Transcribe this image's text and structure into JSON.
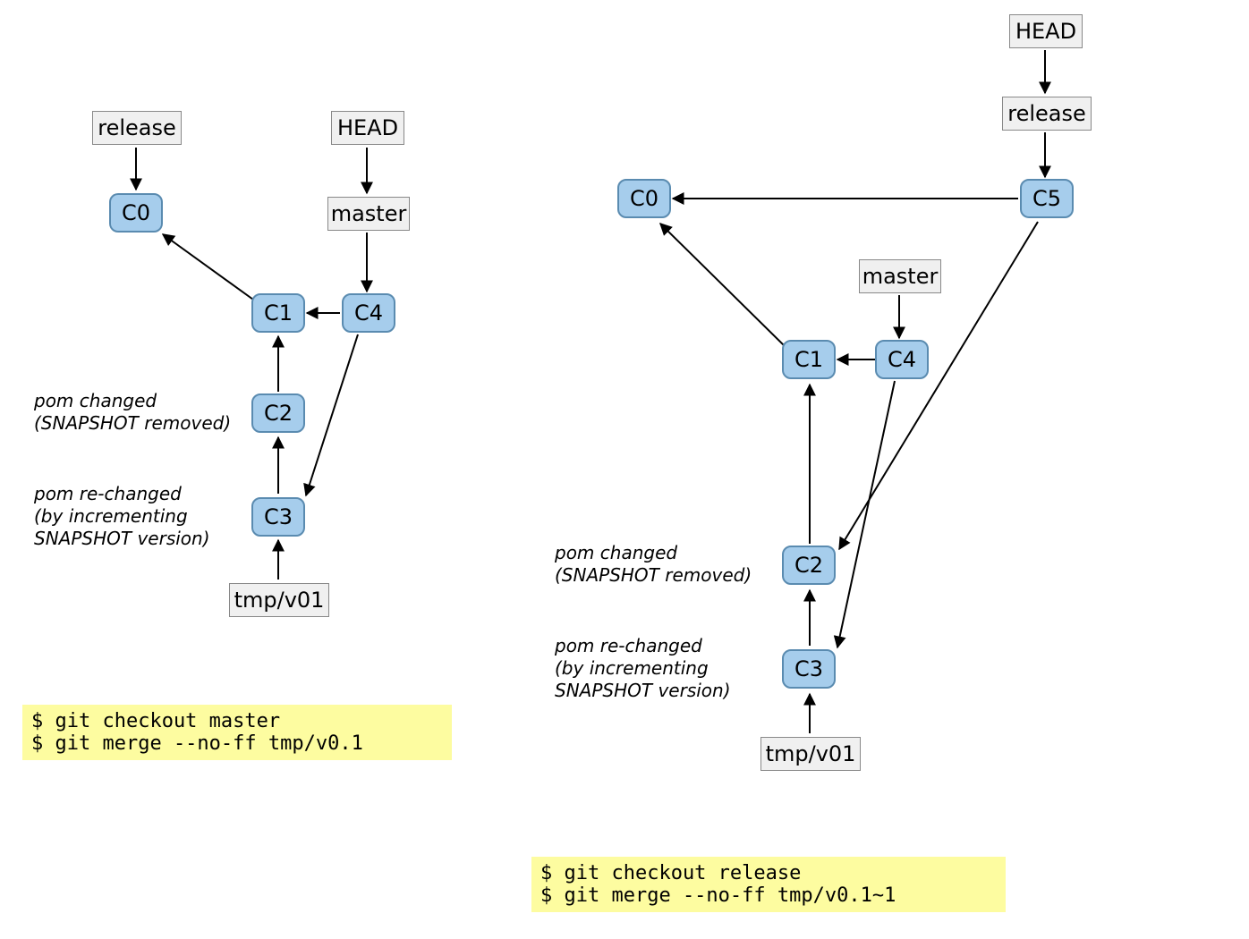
{
  "left": {
    "refs": {
      "release": "release",
      "head": "HEAD",
      "master": "master",
      "tmp": "tmp/v01"
    },
    "commits": {
      "c0": "C0",
      "c1": "C1",
      "c2": "C2",
      "c3": "C3",
      "c4": "C4"
    },
    "annotations": {
      "c2": "pom changed\n(SNAPSHOT removed)",
      "c3": "pom re-changed\n(by incrementing\nSNAPSHOT version)"
    },
    "command": "$ git checkout master\n$ git merge --no-ff tmp/v0.1"
  },
  "right": {
    "refs": {
      "head": "HEAD",
      "release": "release",
      "master": "master",
      "tmp": "tmp/v01"
    },
    "commits": {
      "c0": "C0",
      "c1": "C1",
      "c2": "C2",
      "c3": "C3",
      "c4": "C4",
      "c5": "C5"
    },
    "annotations": {
      "c2": "pom changed\n(SNAPSHOT removed)",
      "c3": "pom re-changed\n(by incrementing\nSNAPSHOT version)"
    },
    "command": "$ git checkout release\n$ git merge --no-ff tmp/v0.1~1"
  }
}
